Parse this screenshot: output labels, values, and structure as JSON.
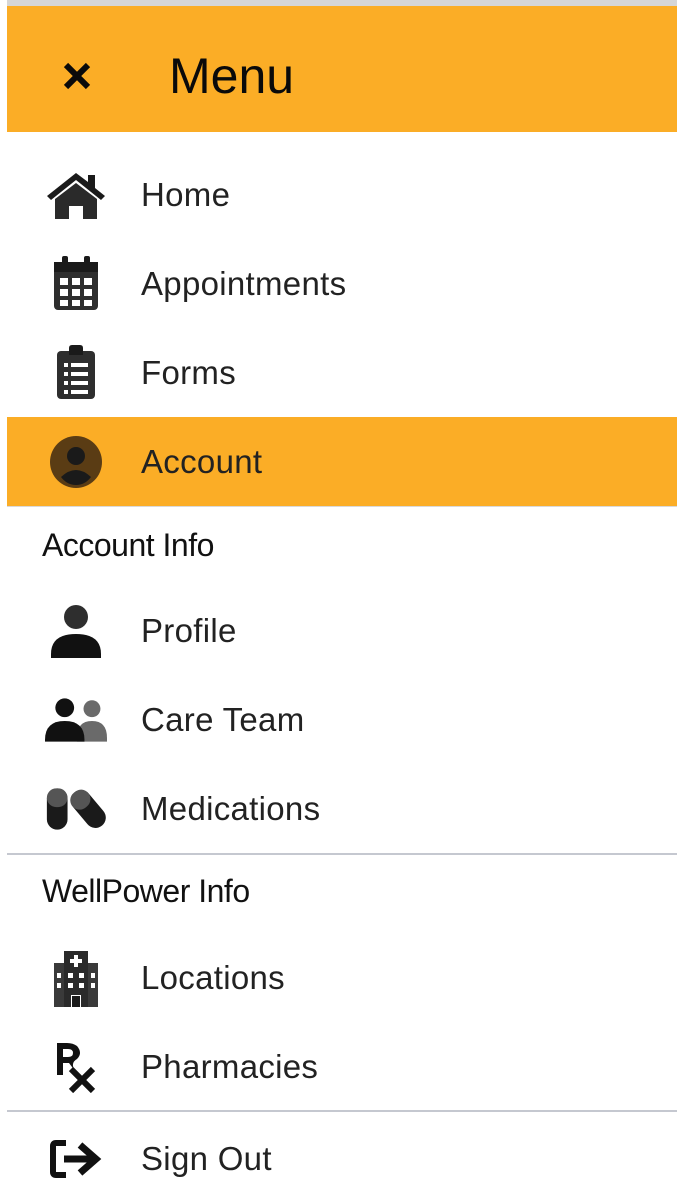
{
  "header": {
    "title": "Menu",
    "close_icon": "close-icon",
    "background": "#fbad26"
  },
  "nav": {
    "items": [
      {
        "label": "Home",
        "icon": "home-icon"
      },
      {
        "label": "Appointments",
        "icon": "calendar-icon"
      },
      {
        "label": "Forms",
        "icon": "clipboard-icon"
      },
      {
        "label": "Account",
        "icon": "account-circle-icon",
        "active": true
      }
    ]
  },
  "account_info": {
    "heading": "Account Info",
    "items": [
      {
        "label": "Profile",
        "icon": "user-icon"
      },
      {
        "label": "Care Team",
        "icon": "users-icon"
      },
      {
        "label": "Medications",
        "icon": "pills-icon"
      }
    ]
  },
  "wellpower_info": {
    "heading": "WellPower Info",
    "items": [
      {
        "label": "Locations",
        "icon": "hospital-icon"
      },
      {
        "label": "Pharmacies",
        "icon": "prescription-icon"
      }
    ]
  },
  "footer": {
    "sign_out_label": "Sign Out",
    "sign_out_icon": "sign-out-icon"
  },
  "colors": {
    "accent": "#fbad26",
    "divider": "#c5c8d0",
    "icon": "#1a1a1a"
  }
}
